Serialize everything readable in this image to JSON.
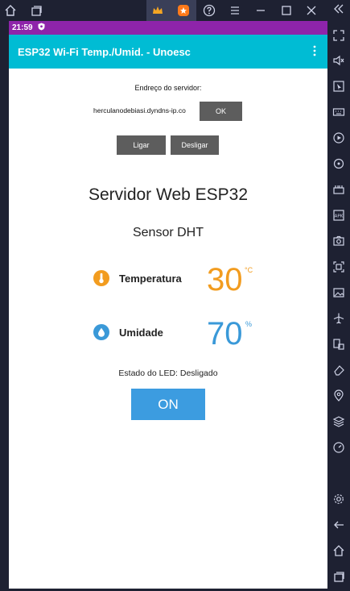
{
  "statusbar": {
    "time": "21:59"
  },
  "appbar": {
    "title": "ESP32 Wi-Fi Temp./Umid. - Unoesc"
  },
  "server": {
    "label": "Endreço do servidor:",
    "value": "herculanodebiasi.dyndns-ip.co",
    "ok_label": "OK"
  },
  "controls": {
    "ligar_label": "Ligar",
    "desligar_label": "Desligar"
  },
  "page": {
    "title": "Servidor Web ESP32",
    "subtitle": "Sensor DHT"
  },
  "temperature": {
    "label": "Temperatura",
    "value": "30",
    "unit": "°C",
    "color": "#f29c1f"
  },
  "humidity": {
    "label": "Umidade",
    "value": "70",
    "unit": "%",
    "color": "#3a99d8"
  },
  "led": {
    "status_text": "Estado do LED: Desligado",
    "button_label": "ON"
  },
  "colors": {
    "statusbar": "#8e24aa",
    "appbar": "#00bcd4",
    "button": "#3c9ce0",
    "gray_button": "#5d5d5d"
  }
}
